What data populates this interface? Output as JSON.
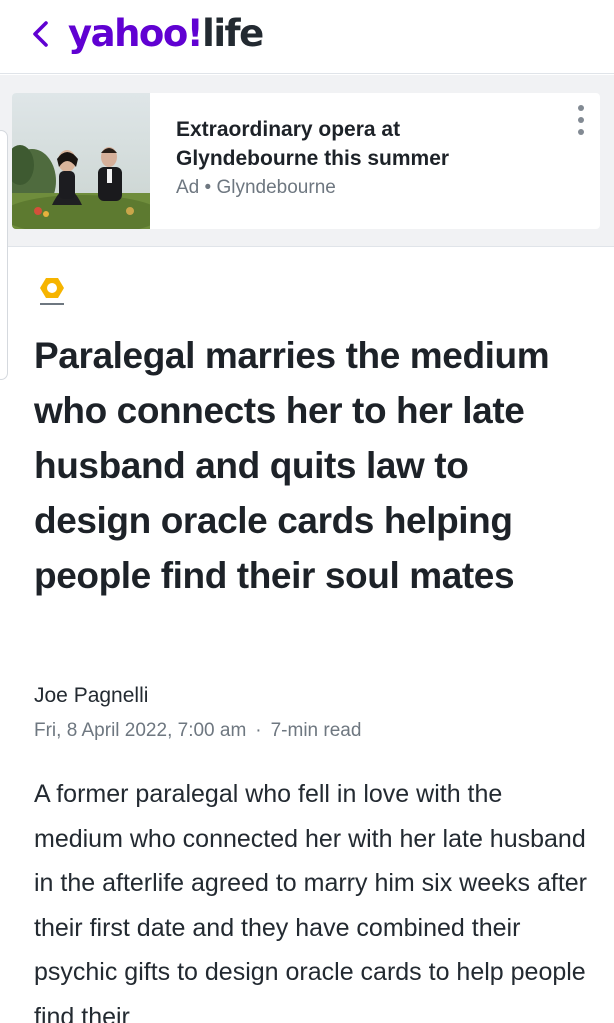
{
  "header": {
    "back_icon": "chevron-left-icon",
    "logo_brand": "yahoo!",
    "logo_section": "life",
    "brand_color": "#6001d2"
  },
  "ad": {
    "title": "Extraordinary opera at Glyndebourne this summer",
    "label": "Ad",
    "separator": "•",
    "sponsor": "Glyndebourne",
    "menu_icon": "more-vertical-icon"
  },
  "article": {
    "provider_icon": "pa-media-logo-icon",
    "headline": "Paralegal marries the medium who connects her to her late husband and quits law to design oracle cards helping people find their soul mates",
    "author": "Joe Pagnelli",
    "date": "Fri, 8 April 2022, 7:00 am",
    "separator": "·",
    "read_time": "7-min read",
    "body": "A former paralegal who fell in love with the medium who connected her with her late husband in the afterlife agreed to marry him six weeks after their first date and they have combined their psychic gifts to design oracle cards to help people find their"
  }
}
